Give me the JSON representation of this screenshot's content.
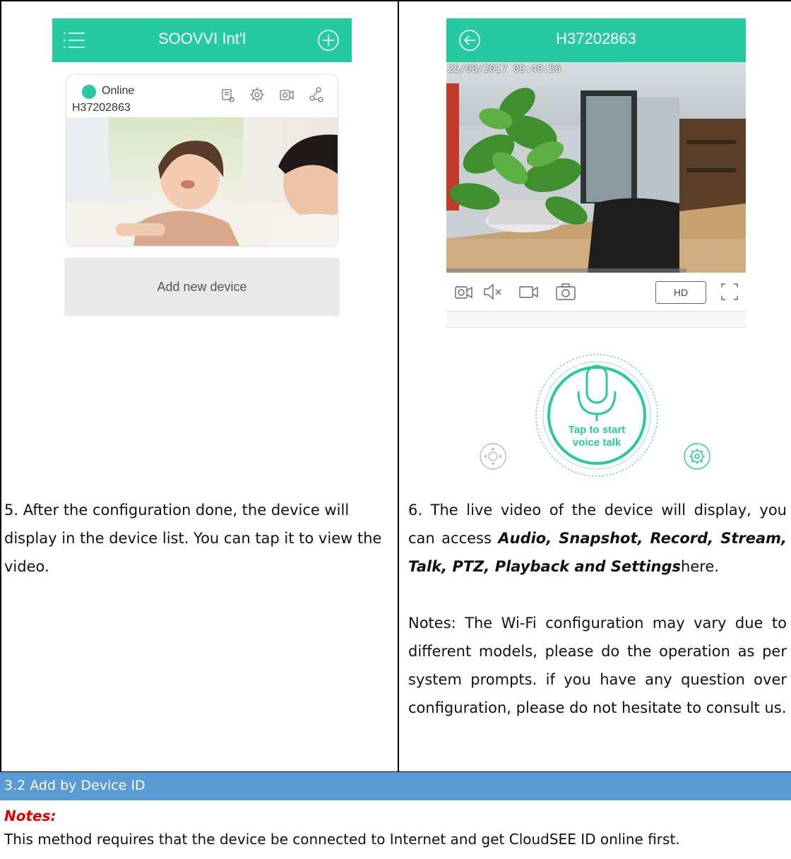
{
  "left_phone": {
    "title": "SOOVVI Int'l",
    "status": "Online",
    "device_id": "H37202863",
    "add_device_label": "Add new device"
  },
  "right_phone": {
    "title": "H37202863",
    "timestamp": "25/08/2017 09:49:56",
    "hd_label": "HD",
    "talk_line1": "Tap to start",
    "talk_line2": "voice talk"
  },
  "step5": {
    "text": "5. After the configuration done, the device will display in the device list. You can tap it to view the video."
  },
  "step6": {
    "prefix": "6. The live video of the device will display, you can access ",
    "features": "Audio, Snapshot, Record, Stream, Talk, PTZ, Playback and Settings",
    "suffix": "here.",
    "notes": "Notes: The Wi-Fi configuration may vary due to different models, please do the operation as per system prompts. if you have any question over configuration, please do not hesitate to consult us."
  },
  "section": {
    "title": "3.2 Add by Device ID",
    "notes_label": "Notes:",
    "notes_text": "This method requires that the device be connected to Internet and get CloudSEE ID online first."
  },
  "colors": {
    "accent": "#27c9a0",
    "section_band": "#5b9bd5",
    "notes_red": "#e00000"
  }
}
